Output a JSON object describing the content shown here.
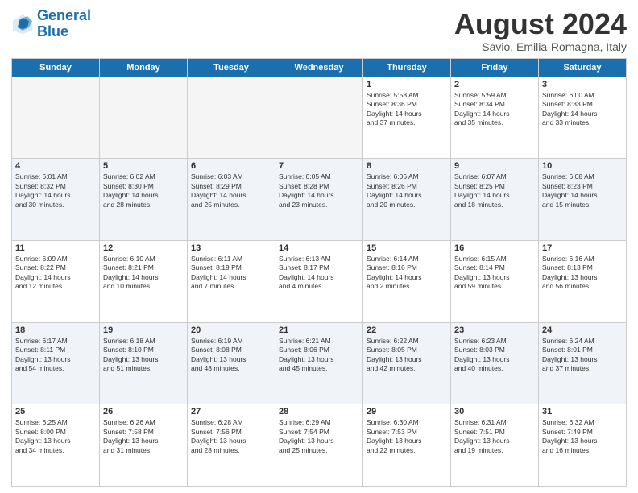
{
  "logo": {
    "line1": "General",
    "line2": "Blue"
  },
  "title": "August 2024",
  "location": "Savio, Emilia-Romagna, Italy",
  "days_of_week": [
    "Sunday",
    "Monday",
    "Tuesday",
    "Wednesday",
    "Thursday",
    "Friday",
    "Saturday"
  ],
  "weeks": [
    [
      {
        "num": "",
        "info": ""
      },
      {
        "num": "",
        "info": ""
      },
      {
        "num": "",
        "info": ""
      },
      {
        "num": "",
        "info": ""
      },
      {
        "num": "1",
        "info": "Sunrise: 5:58 AM\nSunset: 8:36 PM\nDaylight: 14 hours\nand 37 minutes."
      },
      {
        "num": "2",
        "info": "Sunrise: 5:59 AM\nSunset: 8:34 PM\nDaylight: 14 hours\nand 35 minutes."
      },
      {
        "num": "3",
        "info": "Sunrise: 6:00 AM\nSunset: 8:33 PM\nDaylight: 14 hours\nand 33 minutes."
      }
    ],
    [
      {
        "num": "4",
        "info": "Sunrise: 6:01 AM\nSunset: 8:32 PM\nDaylight: 14 hours\nand 30 minutes."
      },
      {
        "num": "5",
        "info": "Sunrise: 6:02 AM\nSunset: 8:30 PM\nDaylight: 14 hours\nand 28 minutes."
      },
      {
        "num": "6",
        "info": "Sunrise: 6:03 AM\nSunset: 8:29 PM\nDaylight: 14 hours\nand 25 minutes."
      },
      {
        "num": "7",
        "info": "Sunrise: 6:05 AM\nSunset: 8:28 PM\nDaylight: 14 hours\nand 23 minutes."
      },
      {
        "num": "8",
        "info": "Sunrise: 6:06 AM\nSunset: 8:26 PM\nDaylight: 14 hours\nand 20 minutes."
      },
      {
        "num": "9",
        "info": "Sunrise: 6:07 AM\nSunset: 8:25 PM\nDaylight: 14 hours\nand 18 minutes."
      },
      {
        "num": "10",
        "info": "Sunrise: 6:08 AM\nSunset: 8:23 PM\nDaylight: 14 hours\nand 15 minutes."
      }
    ],
    [
      {
        "num": "11",
        "info": "Sunrise: 6:09 AM\nSunset: 8:22 PM\nDaylight: 14 hours\nand 12 minutes."
      },
      {
        "num": "12",
        "info": "Sunrise: 6:10 AM\nSunset: 8:21 PM\nDaylight: 14 hours\nand 10 minutes."
      },
      {
        "num": "13",
        "info": "Sunrise: 6:11 AM\nSunset: 8:19 PM\nDaylight: 14 hours\nand 7 minutes."
      },
      {
        "num": "14",
        "info": "Sunrise: 6:13 AM\nSunset: 8:17 PM\nDaylight: 14 hours\nand 4 minutes."
      },
      {
        "num": "15",
        "info": "Sunrise: 6:14 AM\nSunset: 8:16 PM\nDaylight: 14 hours\nand 2 minutes."
      },
      {
        "num": "16",
        "info": "Sunrise: 6:15 AM\nSunset: 8:14 PM\nDaylight: 13 hours\nand 59 minutes."
      },
      {
        "num": "17",
        "info": "Sunrise: 6:16 AM\nSunset: 8:13 PM\nDaylight: 13 hours\nand 56 minutes."
      }
    ],
    [
      {
        "num": "18",
        "info": "Sunrise: 6:17 AM\nSunset: 8:11 PM\nDaylight: 13 hours\nand 54 minutes."
      },
      {
        "num": "19",
        "info": "Sunrise: 6:18 AM\nSunset: 8:10 PM\nDaylight: 13 hours\nand 51 minutes."
      },
      {
        "num": "20",
        "info": "Sunrise: 6:19 AM\nSunset: 8:08 PM\nDaylight: 13 hours\nand 48 minutes."
      },
      {
        "num": "21",
        "info": "Sunrise: 6:21 AM\nSunset: 8:06 PM\nDaylight: 13 hours\nand 45 minutes."
      },
      {
        "num": "22",
        "info": "Sunrise: 6:22 AM\nSunset: 8:05 PM\nDaylight: 13 hours\nand 42 minutes."
      },
      {
        "num": "23",
        "info": "Sunrise: 6:23 AM\nSunset: 8:03 PM\nDaylight: 13 hours\nand 40 minutes."
      },
      {
        "num": "24",
        "info": "Sunrise: 6:24 AM\nSunset: 8:01 PM\nDaylight: 13 hours\nand 37 minutes."
      }
    ],
    [
      {
        "num": "25",
        "info": "Sunrise: 6:25 AM\nSunset: 8:00 PM\nDaylight: 13 hours\nand 34 minutes."
      },
      {
        "num": "26",
        "info": "Sunrise: 6:26 AM\nSunset: 7:58 PM\nDaylight: 13 hours\nand 31 minutes."
      },
      {
        "num": "27",
        "info": "Sunrise: 6:28 AM\nSunset: 7:56 PM\nDaylight: 13 hours\nand 28 minutes."
      },
      {
        "num": "28",
        "info": "Sunrise: 6:29 AM\nSunset: 7:54 PM\nDaylight: 13 hours\nand 25 minutes."
      },
      {
        "num": "29",
        "info": "Sunrise: 6:30 AM\nSunset: 7:53 PM\nDaylight: 13 hours\nand 22 minutes."
      },
      {
        "num": "30",
        "info": "Sunrise: 6:31 AM\nSunset: 7:51 PM\nDaylight: 13 hours\nand 19 minutes."
      },
      {
        "num": "31",
        "info": "Sunrise: 6:32 AM\nSunset: 7:49 PM\nDaylight: 13 hours\nand 16 minutes."
      }
    ]
  ]
}
